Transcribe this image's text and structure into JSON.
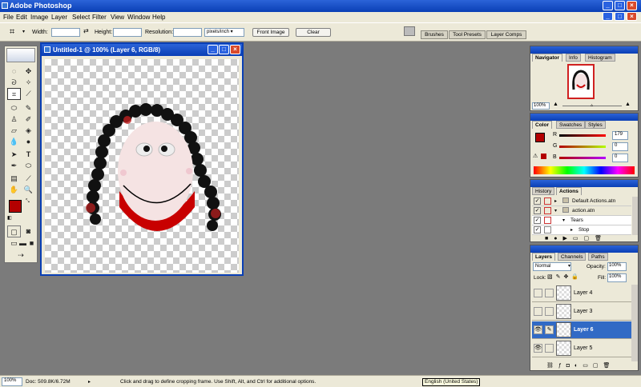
{
  "app": {
    "title": "Adobe Photoshop"
  },
  "menu": [
    "File",
    "Edit",
    "Image",
    "Layer",
    "Select",
    "Filter",
    "View",
    "Window",
    "Help"
  ],
  "options": {
    "width_label": "Width:",
    "height_label": "Height:",
    "resolution_label": "Resolution:",
    "units": "pixels/inch",
    "front_image": "Front Image",
    "clear": "Clear"
  },
  "palette_well": {
    "tabs": [
      "Brushes",
      "Tool Presets",
      "Layer Comps"
    ]
  },
  "document": {
    "title": "Untitled-1 @ 100% (Layer 6, RGB/8)"
  },
  "navigator": {
    "tabs": [
      "Navigator",
      "Info",
      "Histogram"
    ],
    "zoom": "100%"
  },
  "color": {
    "tabs": [
      "Color",
      "Swatches",
      "Styles"
    ],
    "channels": [
      {
        "label": "R",
        "value": "179"
      },
      {
        "label": "G",
        "value": "0"
      },
      {
        "label": "B",
        "value": "0"
      }
    ]
  },
  "actions": {
    "tabs": [
      "History",
      "Actions"
    ],
    "items": [
      "Default Actions.atn",
      "action.atn",
      "Tears",
      "Stop"
    ]
  },
  "layers": {
    "tabs": [
      "Layers",
      "Channels",
      "Paths"
    ],
    "blend_mode": "Normal",
    "opacity_label": "Opacity:",
    "opacity": "100%",
    "lock_label": "Lock:",
    "fill_label": "Fill:",
    "fill": "100%",
    "items": [
      "Layer 4",
      "Layer 3",
      "Layer 6",
      "Layer 5"
    ]
  },
  "status": {
    "zoom": "100%",
    "doc": "Doc: 509.8K/6.72M",
    "hint": "Click and drag to define cropping frame. Use Shift, Alt, and Ctrl for additional options.",
    "language": "English (United States)"
  },
  "colors": {
    "foreground": "#b30000",
    "background": "#ffffff",
    "selection": "#316ac5"
  }
}
